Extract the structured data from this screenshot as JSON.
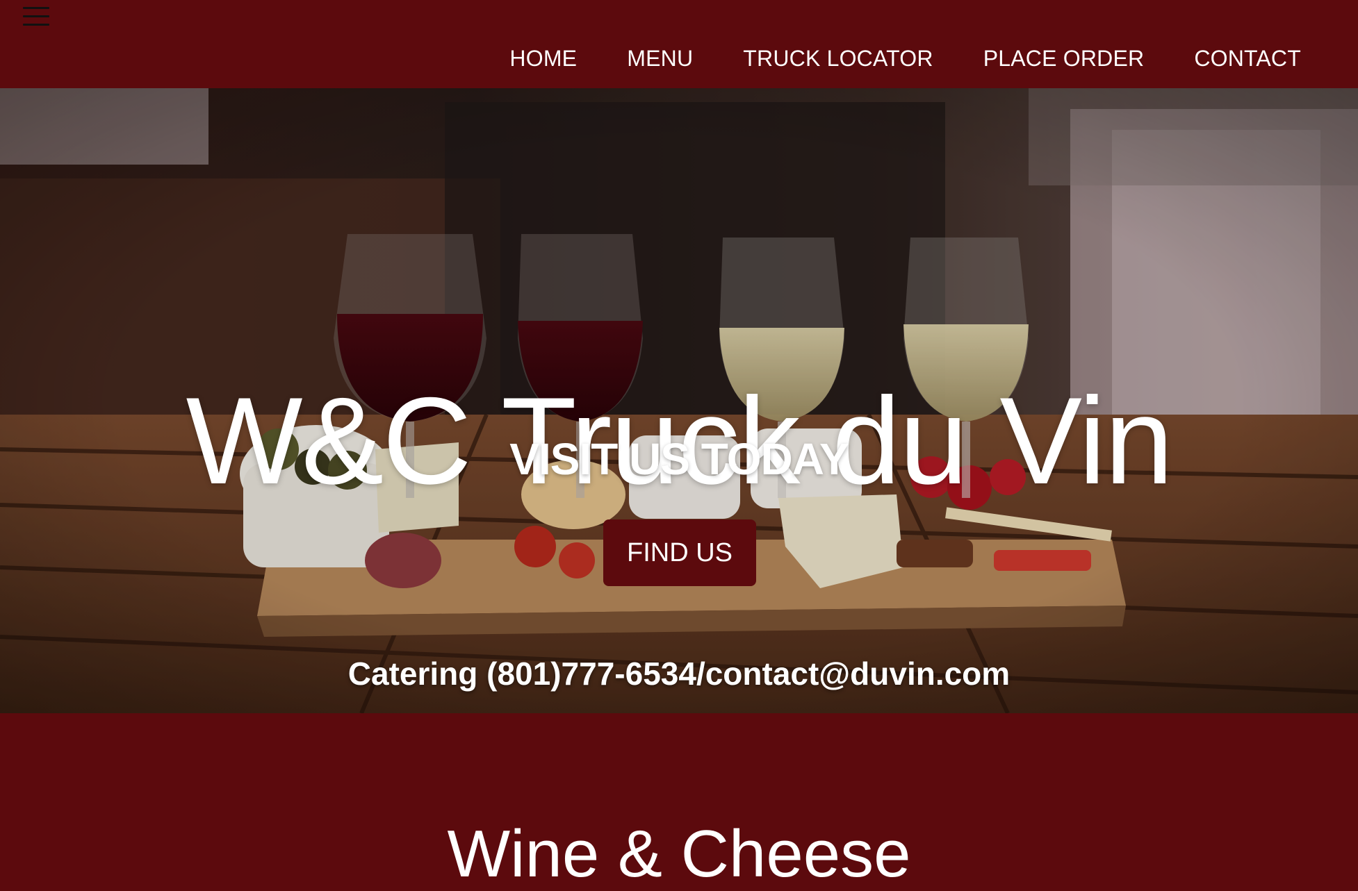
{
  "nav": {
    "menu_icon": "hamburger-menu-icon",
    "items": [
      {
        "label": "HOME"
      },
      {
        "label": "MENU"
      },
      {
        "label": "TRUCK LOCATOR"
      },
      {
        "label": "PLACE ORDER"
      },
      {
        "label": "CONTACT"
      }
    ]
  },
  "hero": {
    "title": "W&C Truck du Vin",
    "subtitle": "VISIT US TODAY",
    "button_label": "FIND US",
    "catering": "Catering (801)777-6534/contact@duvin.com"
  },
  "section": {
    "title": "Wine & Cheese"
  },
  "colors": {
    "brand": "#5c0a0d",
    "text": "#ffffff"
  }
}
